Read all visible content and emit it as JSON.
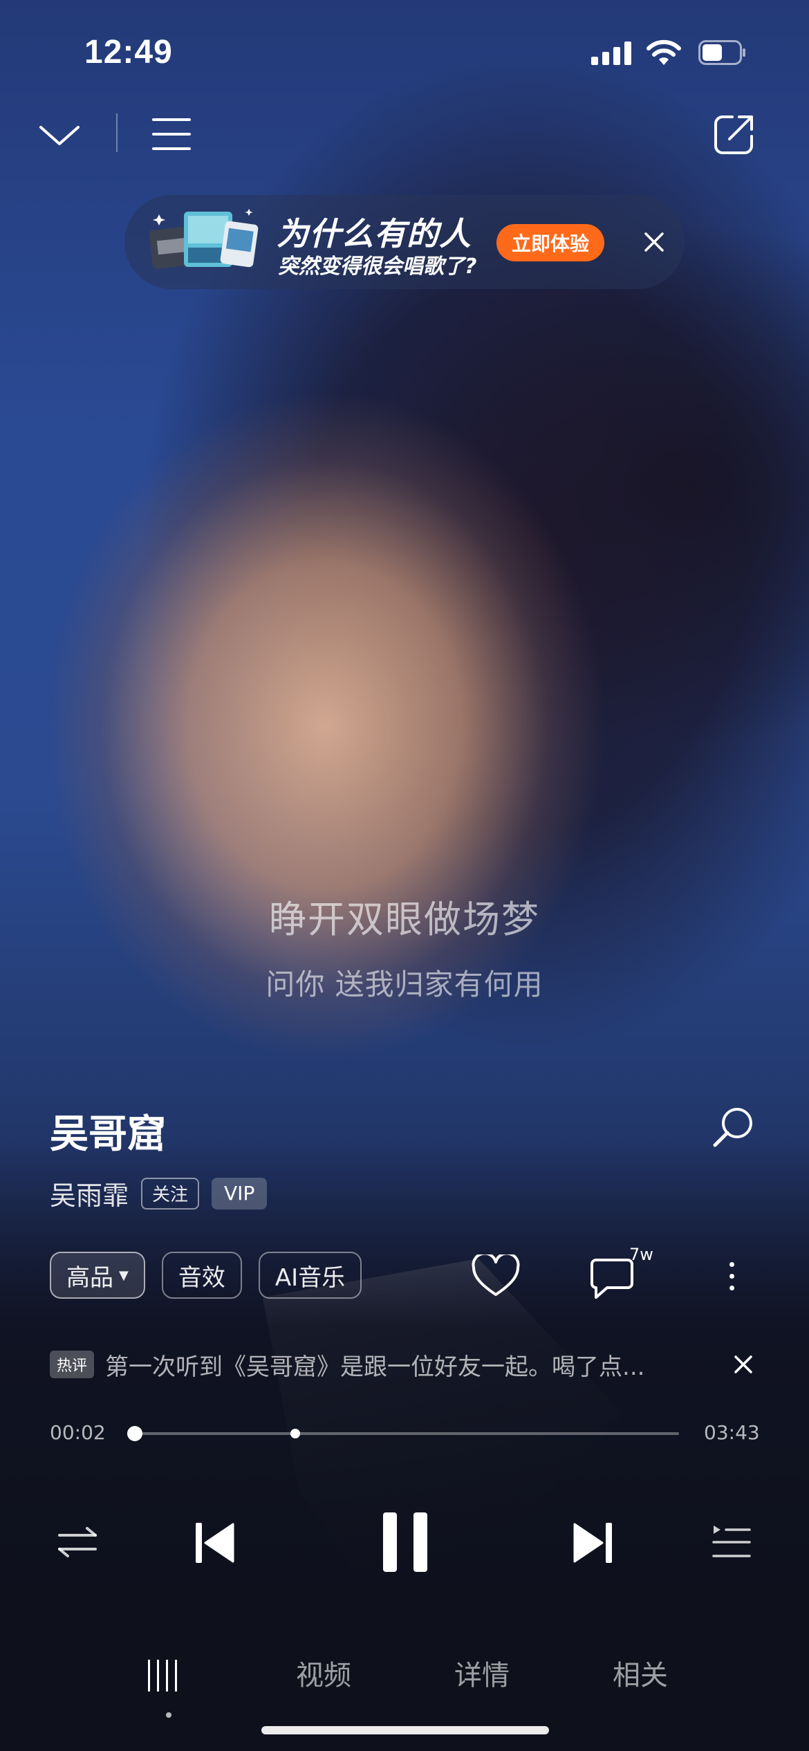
{
  "status_bar": {
    "time": "12:49"
  },
  "banner": {
    "title": "为什么有的人",
    "subtitle": "突然变得很会唱歌了?",
    "cta": "立即体验",
    "accent": "#ff6a1a"
  },
  "lyrics": {
    "current": "睁开双眼做场梦",
    "next": "问你 送我归家有何用"
  },
  "song": {
    "title": "吴哥窟",
    "artist": "吴雨霏",
    "follow_label": "关注",
    "vip_label": "VIP"
  },
  "options": {
    "quality": "高品",
    "effects": "音效",
    "ai_music": "AI音乐",
    "comment_count": "7w"
  },
  "hot_comment": {
    "tag": "热评",
    "text": "第一次听到《吴哥窟》是跟一位好友一起。喝了点..."
  },
  "progress": {
    "current_time": "00:02",
    "total_time": "03:43",
    "position_fraction": 0.009
  },
  "tabs": [
    {
      "label": "视频"
    },
    {
      "label": "详情"
    },
    {
      "label": "相关"
    }
  ],
  "icons": {
    "collapse": "chevron-down-icon",
    "menu": "menu-icon",
    "share": "share-icon",
    "search_lyrics": "search-icon",
    "like": "heart-icon",
    "comment": "comment-icon",
    "more": "more-icon",
    "repeat": "repeat-icon",
    "previous": "skip-previous-icon",
    "pause": "pause-icon",
    "next": "skip-next-icon",
    "playlist": "playlist-icon"
  }
}
